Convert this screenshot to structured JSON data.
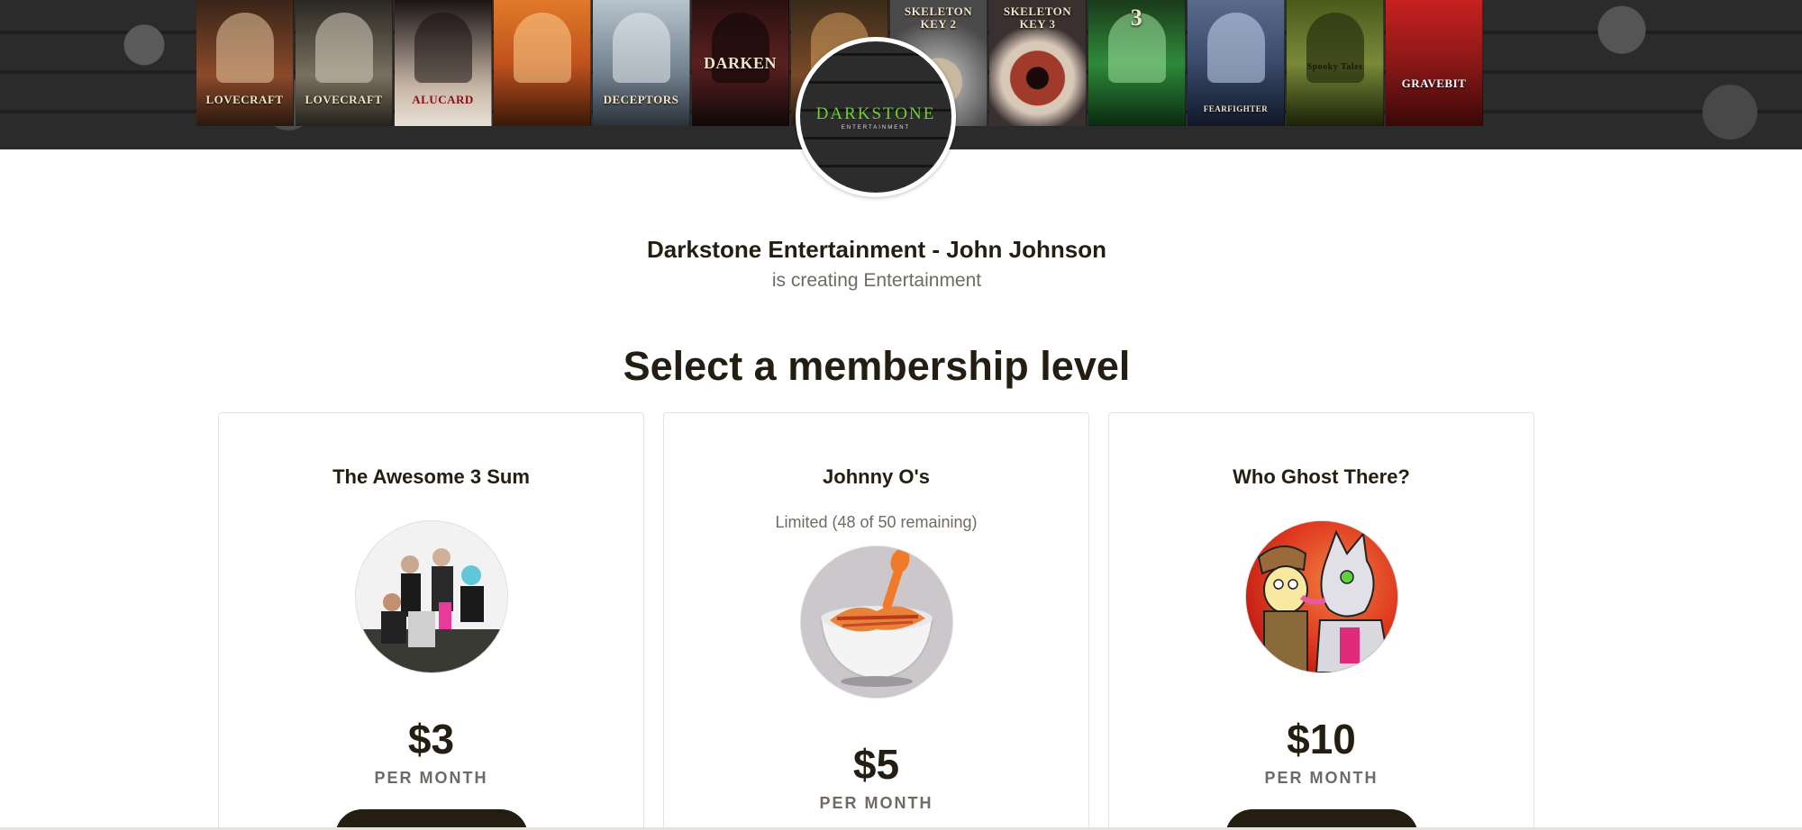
{
  "banner": {
    "posters": [
      {
        "title": "LOVECRAFT",
        "color": "#8a4a2a"
      },
      {
        "title": "LOVECRAFT",
        "color": "#7a7060"
      },
      {
        "title": "ALUCARD",
        "color": "#c9b8a8"
      },
      {
        "title": "",
        "color": "#c0521e"
      },
      {
        "title": "DECEPTORS",
        "color": "#6f7d8a"
      },
      {
        "title": "DARKEN",
        "color": "#5a2020"
      },
      {
        "title": "",
        "color": "#7a4a2a"
      },
      {
        "title": "SKELETON KEY 2",
        "color": "#9a9a9a"
      },
      {
        "title": "SKELETON KEY 3",
        "color": "#a03a2a"
      },
      {
        "title": "3",
        "color": "#2f8a3a"
      },
      {
        "title": "FEARFIGHTER",
        "color": "#3a4a6a"
      },
      {
        "title": "Spooky Tales",
        "color": "#7a8a3a"
      },
      {
        "title": "GRAVEBIT",
        "color": "#8a1818"
      }
    ]
  },
  "creator": {
    "avatar_title": "DARKSTONE",
    "avatar_subtitle": "ENTERTAINMENT",
    "name": "Darkstone Entertainment - John Johnson",
    "subtitle": "is creating Entertainment"
  },
  "section_title": "Select a membership level",
  "tiers": [
    {
      "name": "The Awesome 3 Sum",
      "limit": "",
      "price": "$3",
      "period": "PER MONTH",
      "image_icon": "group-photo"
    },
    {
      "name": "Johnny O's",
      "limit": "Limited (48 of 50 remaining)",
      "price": "$5",
      "period": "PER MONTH",
      "image_icon": "food-bowl"
    },
    {
      "name": "Who Ghost There?",
      "limit": "",
      "price": "$10",
      "period": "PER MONTH",
      "image_icon": "cartoon-characters"
    }
  ]
}
